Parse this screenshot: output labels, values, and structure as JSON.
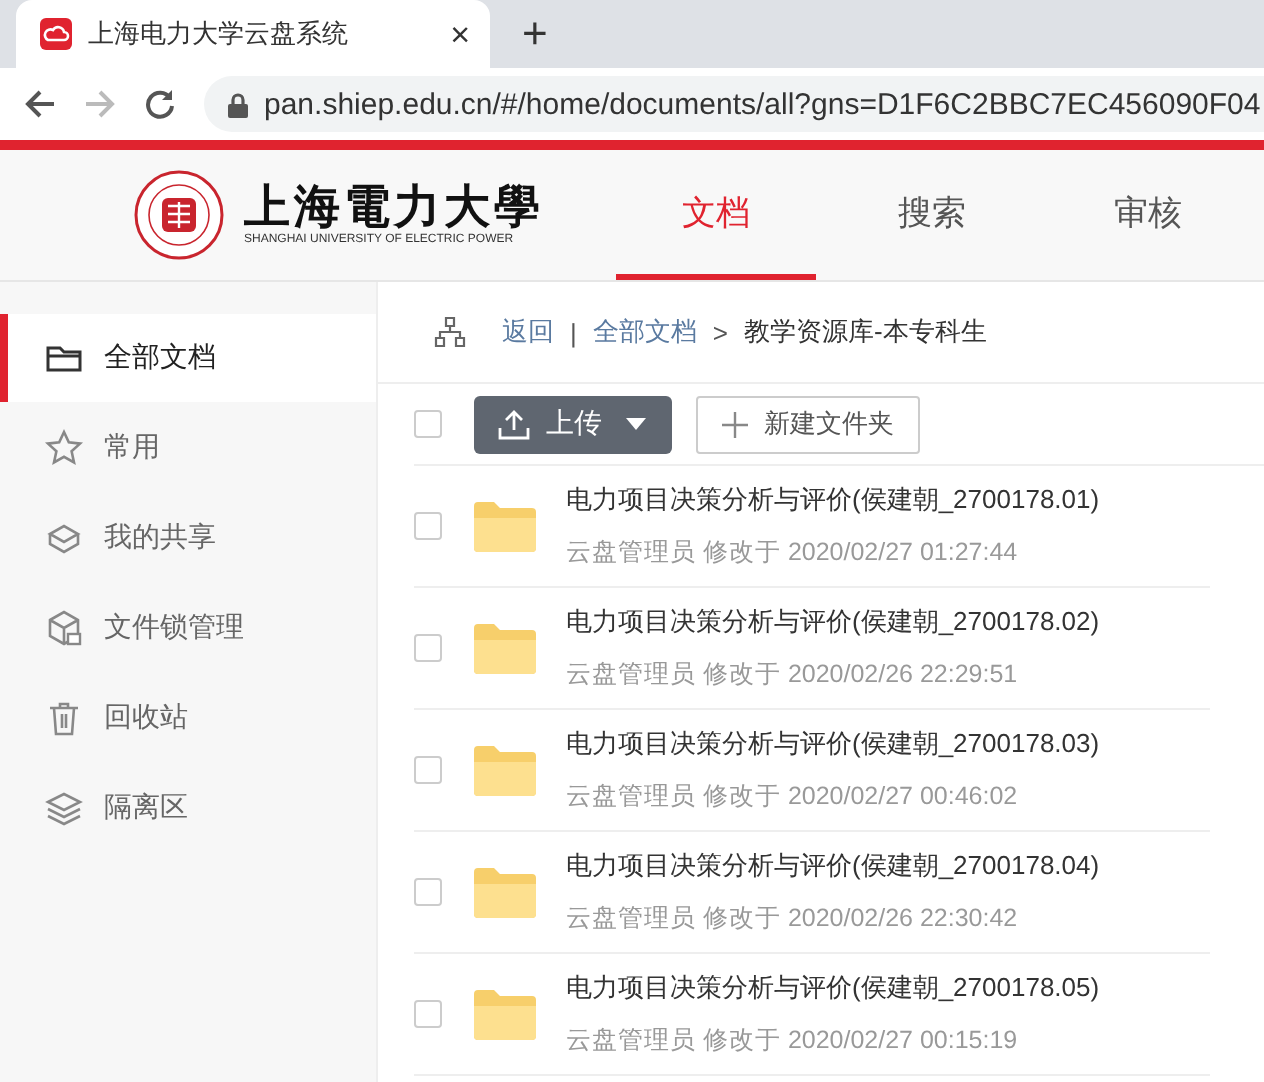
{
  "browser": {
    "tab_title": "上海电力大学云盘系统",
    "close": "×",
    "new_tab": "+",
    "url": "pan.shiep.edu.cn/#/home/documents/all?gns=D1F6C2BBC7EC456090F04"
  },
  "header": {
    "logo_title": "上海電力大學",
    "logo_subtitle": "SHANGHAI UNIVERSITY OF ELECTRIC POWER",
    "nav": [
      {
        "label": "文档",
        "selected": true
      },
      {
        "label": "搜索",
        "selected": false
      },
      {
        "label": "审核",
        "selected": false
      }
    ]
  },
  "sidebar": {
    "items": [
      {
        "kind": "folder",
        "label": "全部文档",
        "selected": true
      },
      {
        "kind": "star",
        "label": "常用",
        "selected": false
      },
      {
        "kind": "share",
        "label": "我的共享",
        "selected": false
      },
      {
        "kind": "lock",
        "label": "文件锁管理",
        "selected": false
      },
      {
        "kind": "trash",
        "label": "回收站",
        "selected": false
      },
      {
        "kind": "layers",
        "label": "隔离区",
        "selected": false
      }
    ]
  },
  "breadcrumb": {
    "back": "返回",
    "separator": "|",
    "items": [
      "全部文档",
      "教学资源库-本专科生"
    ],
    "arrow": ">"
  },
  "toolbar": {
    "select_all_checked": false,
    "upload": "上传",
    "new_folder": "新建文件夹"
  },
  "files": [
    {
      "name": "电力项目决策分析与评价(侯建朝_2700178.01)",
      "meta": "云盘管理员 修改于 2020/02/27 01:27:44",
      "checked": false
    },
    {
      "name": "电力项目决策分析与评价(侯建朝_2700178.02)",
      "meta": "云盘管理员 修改于 2020/02/26 22:29:51",
      "checked": false
    },
    {
      "name": "电力项目决策分析与评价(侯建朝_2700178.03)",
      "meta": "云盘管理员 修改于 2020/02/27 00:46:02",
      "checked": false
    },
    {
      "name": "电力项目决策分析与评价(侯建朝_2700178.04)",
      "meta": "云盘管理员 修改于 2020/02/26 22:30:42",
      "checked": false
    },
    {
      "name": "电力项目决策分析与评价(侯建朝_2700178.05)",
      "meta": "云盘管理员 修改于 2020/02/27 00:15:19",
      "checked": false
    }
  ]
}
